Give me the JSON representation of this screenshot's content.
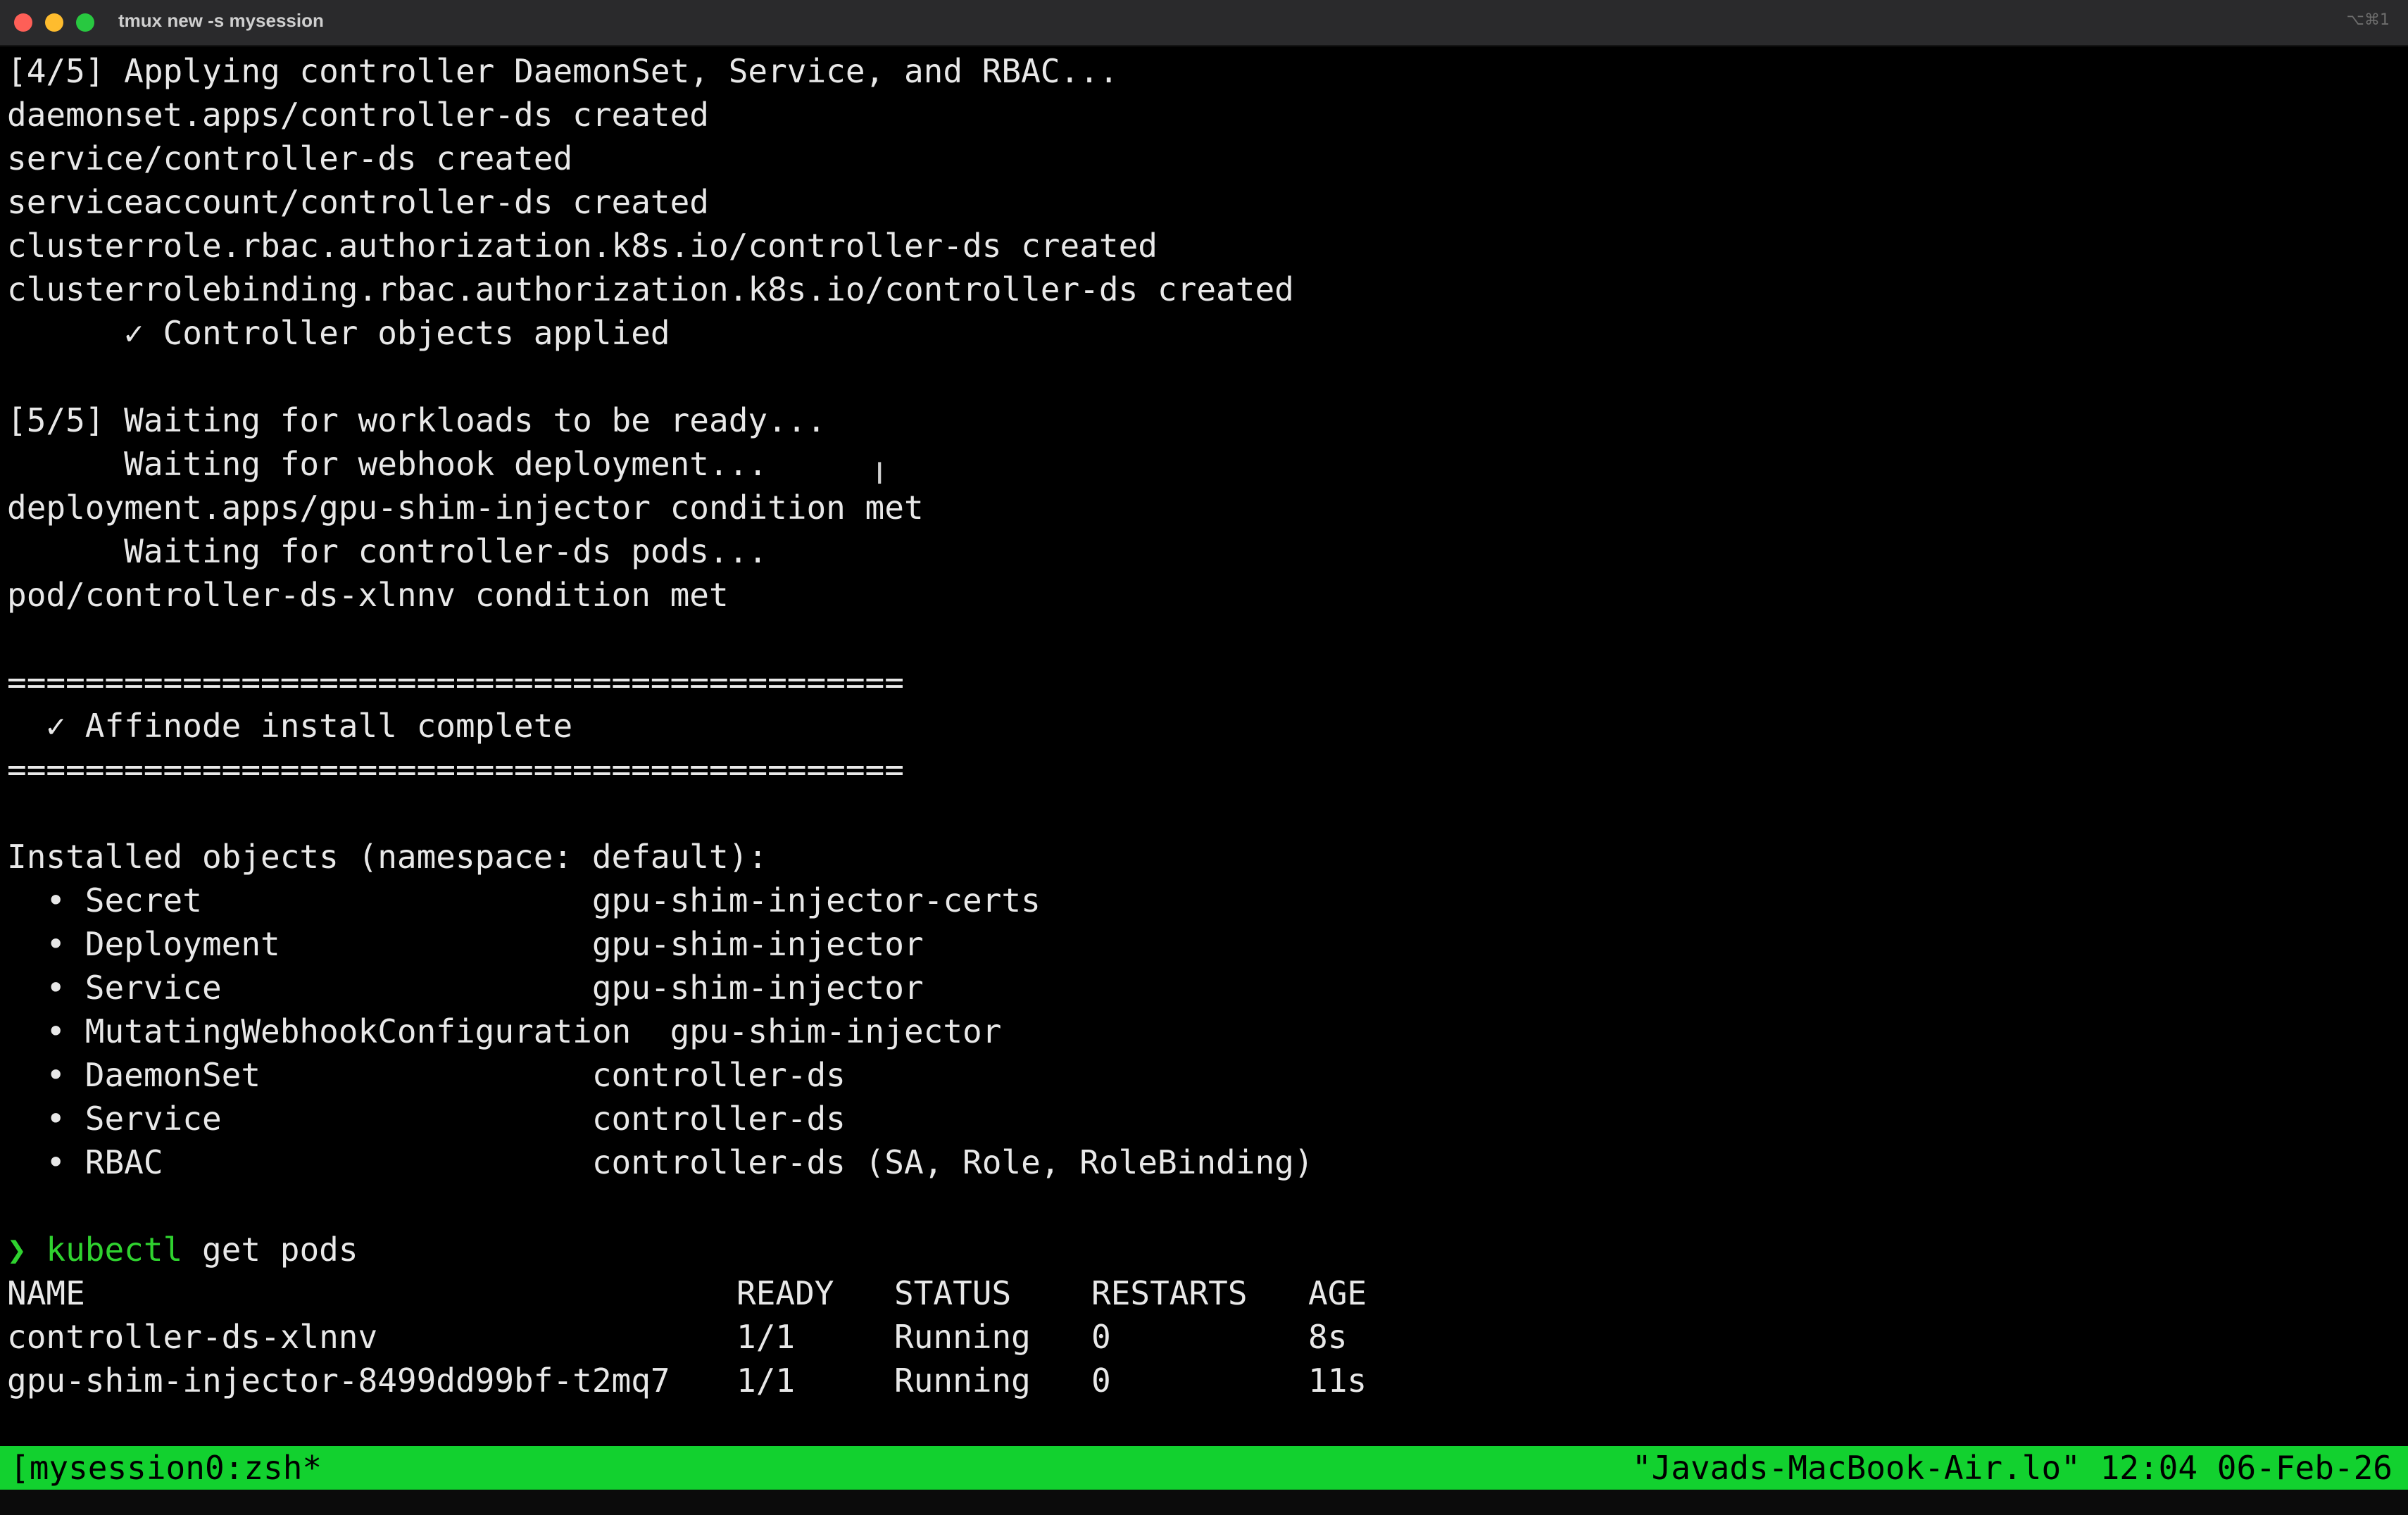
{
  "window": {
    "title": "tmux new -s mysession",
    "shortcut": "⌥⌘1"
  },
  "terminal": {
    "lines": [
      "[4/5] Applying controller DaemonSet, Service, and RBAC...",
      "daemonset.apps/controller-ds created",
      "service/controller-ds created",
      "serviceaccount/controller-ds created",
      "clusterrole.rbac.authorization.k8s.io/controller-ds created",
      "clusterrolebinding.rbac.authorization.k8s.io/controller-ds created",
      "      ✓ Controller objects applied",
      "",
      "[5/5] Waiting for workloads to be ready...",
      "      Waiting for webhook deployment...",
      "deployment.apps/gpu-shim-injector condition met",
      "      Waiting for controller-ds pods...",
      "pod/controller-ds-xlnnv condition met",
      "",
      "==============================================",
      "  ✓ Affinode install complete",
      "==============================================",
      "",
      "Installed objects (namespace: default):",
      "  • Secret                    gpu-shim-injector-certs",
      "  • Deployment                gpu-shim-injector",
      "  • Service                   gpu-shim-injector",
      "  • MutatingWebhookConfiguration  gpu-shim-injector",
      "  • DaemonSet                 controller-ds",
      "  • Service                   controller-ds",
      "  • RBAC                      controller-ds (SA, Role, RoleBinding)",
      ""
    ],
    "command": {
      "prompt_symbol": "❯",
      "program": "kubectl",
      "args": " get pods"
    },
    "pods_table": {
      "headers": [
        "NAME",
        "READY",
        "STATUS",
        "RESTARTS",
        "AGE"
      ],
      "rows": [
        [
          "controller-ds-xlnnv",
          "1/1",
          "Running",
          "0",
          "8s"
        ],
        [
          "gpu-shim-injector-8499dd99bf-t2mq7",
          "1/1",
          "Running",
          "0",
          "11s"
        ]
      ]
    },
    "prompt": {
      "apple_icon": "apple-icon",
      "home_icon": "home-icon",
      "path": "~",
      "symbol": "❯"
    }
  },
  "statusbar": {
    "session": "[mysession0:zsh*",
    "host": "\"Javads-MacBook-Air.lo\"",
    "time": "12:04",
    "date": "06-Feb-26"
  },
  "colors": {
    "status_bg": "#12d12f",
    "prompt_green": "#2fd22f",
    "terminal_bg": "#000000",
    "text": "#e8e8e8"
  }
}
